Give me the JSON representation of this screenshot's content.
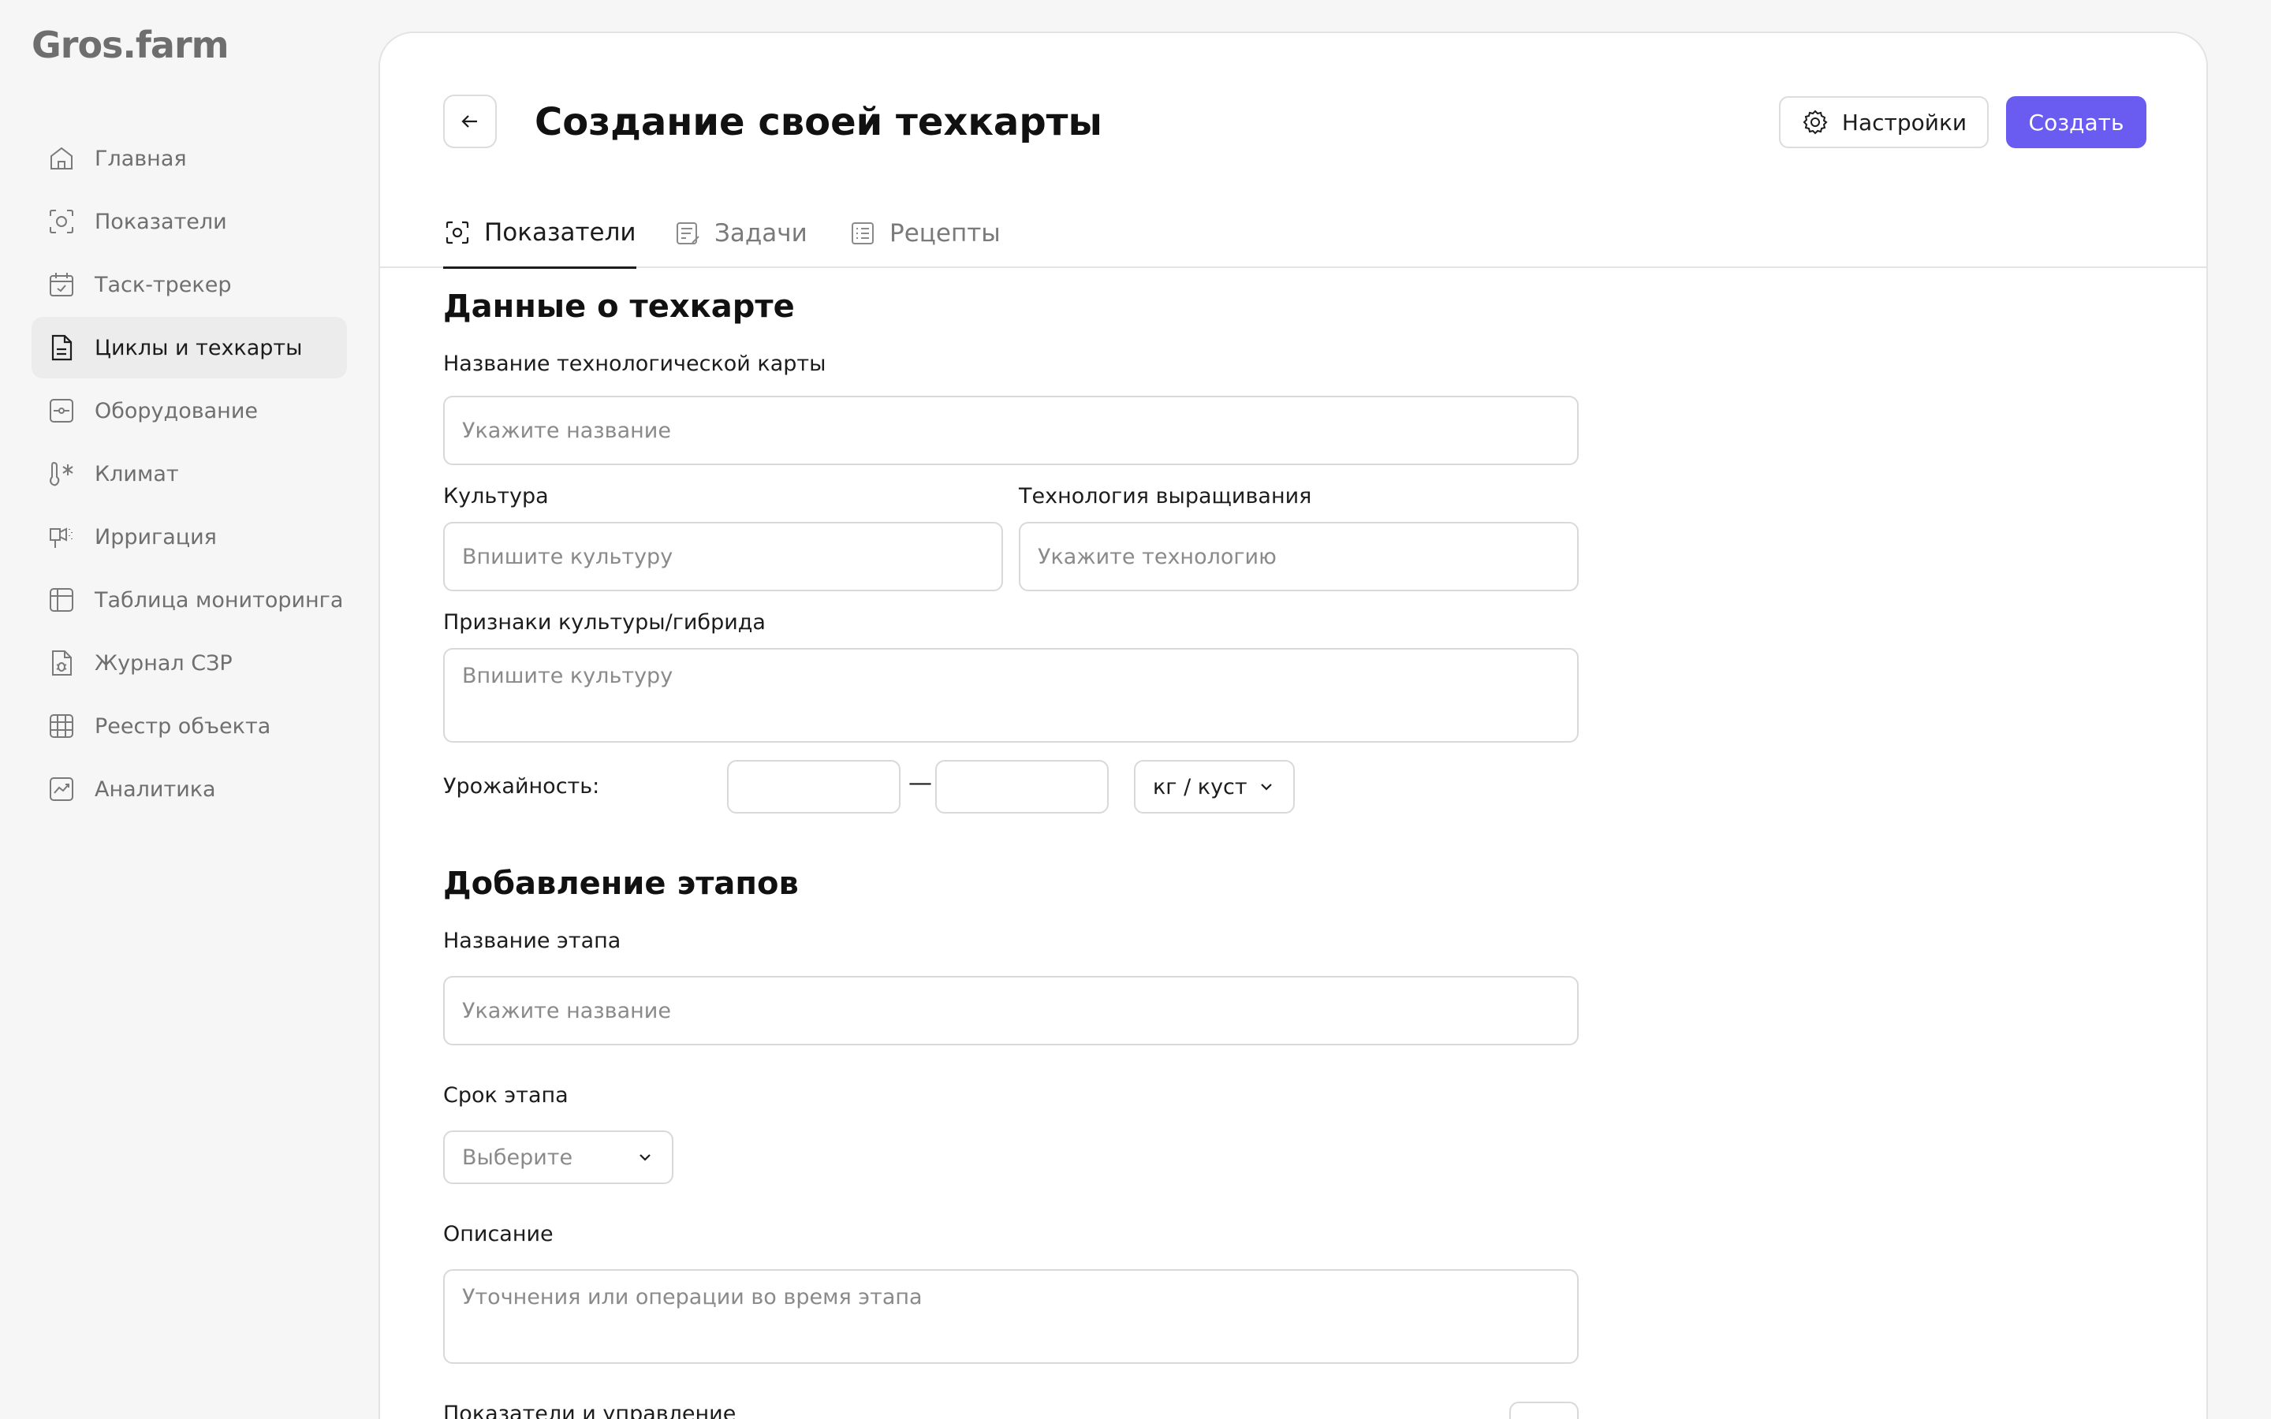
{
  "brand": {
    "logo_text": "Gros.farm"
  },
  "sidebar": {
    "items": [
      {
        "label": "Главная",
        "icon": "home-icon"
      },
      {
        "label": "Показатели",
        "icon": "indicators-icon"
      },
      {
        "label": "Таск-трекер",
        "icon": "calendar-check-icon"
      },
      {
        "label": "Циклы и техкарты",
        "icon": "document-icon",
        "active": true
      },
      {
        "label": "Оборудование",
        "icon": "equipment-icon"
      },
      {
        "label": "Климат",
        "icon": "thermometer-snow-icon"
      },
      {
        "label": "Ирригация",
        "icon": "irrigation-icon"
      },
      {
        "label": "Таблица мониторинга",
        "icon": "table-icon"
      },
      {
        "label": "Журнал СЗР",
        "icon": "journal-bug-icon"
      },
      {
        "label": "Реестр объекта",
        "icon": "grid-icon"
      },
      {
        "label": "Аналитика",
        "icon": "analytics-icon"
      }
    ]
  },
  "header": {
    "title": "Создание своей техкарты",
    "settings_label": "Настройки",
    "create_label": "Создать"
  },
  "tabs": [
    {
      "label": "Показатели",
      "active": true
    },
    {
      "label": "Задачи"
    },
    {
      "label": "Рецепты"
    }
  ],
  "techcard": {
    "section_title": "Данные о техкарте",
    "name_label": "Название технологической карты",
    "name_placeholder": "Укажите название",
    "culture_label": "Культура",
    "culture_placeholder": "Впишите культуру",
    "technology_label": "Технология выращивания",
    "technology_placeholder": "Укажите технологию",
    "traits_label": "Признаки культуры/гибрида",
    "traits_placeholder": "Впишите культуру",
    "yield_label": "Урожайность:",
    "yield_from": "",
    "yield_to": "",
    "yield_dash": "—",
    "yield_unit": "кг / куст"
  },
  "stages": {
    "section_title": "Добавление этапов",
    "stage_name_label": "Название этапа",
    "stage_name_placeholder": "Укажите название",
    "term_label": "Срок этапа",
    "term_placeholder": "Выберите",
    "description_label": "Описание",
    "description_placeholder": "Уточнения или операции во время этапа",
    "controls_label": "Показатели и управление"
  },
  "colors": {
    "accent": "#6a5cf0",
    "background": "#f6f6f6",
    "active_nav": "#ececec"
  }
}
